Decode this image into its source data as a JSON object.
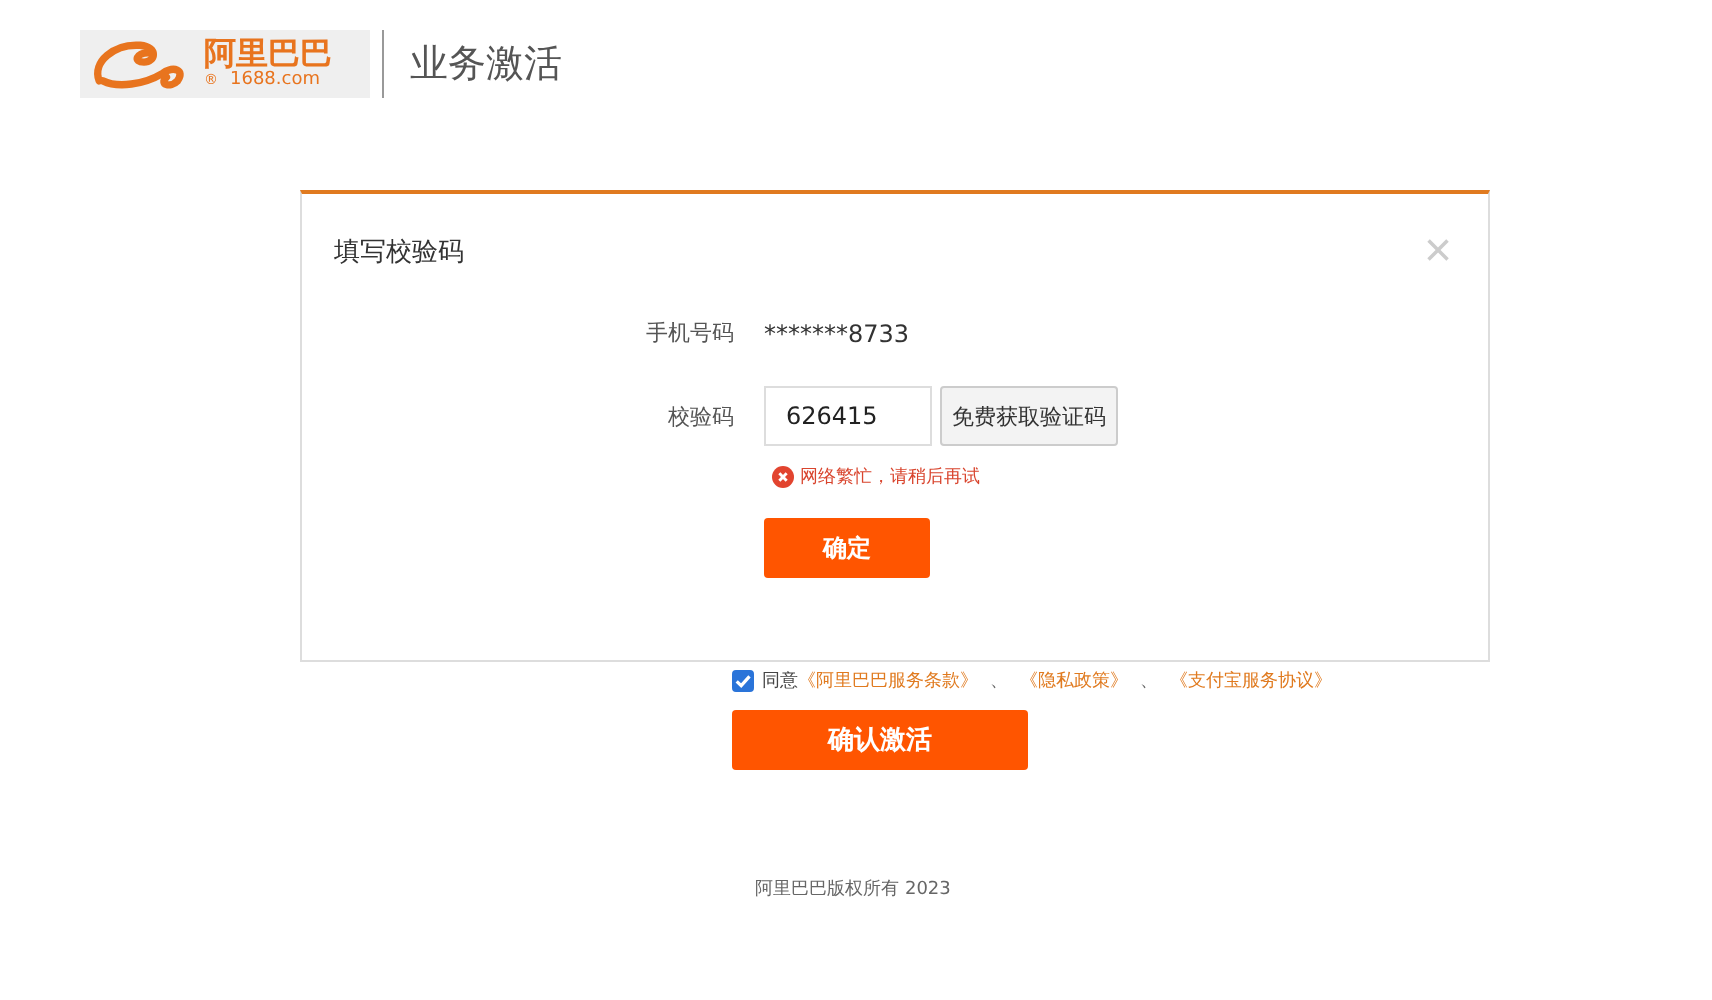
{
  "header": {
    "logo": {
      "name": "阿里巴巴",
      "domain": "1688.com",
      "mark": "®"
    },
    "title": "业务激活"
  },
  "dialog": {
    "title": "填写校验码",
    "close": "×",
    "phone": {
      "label": "手机号码",
      "value": "*******8733"
    },
    "code": {
      "label": "校验码",
      "value": "626415",
      "button": "免费获取验证码"
    },
    "error": "网络繁忙，请稍后再试",
    "confirm": "确定"
  },
  "agreement": {
    "checked": true,
    "prefix": "同意",
    "links": [
      "《阿里巴巴服务条款》",
      "《隐私政策》",
      "《支付宝服务协议》"
    ],
    "separators": [
      "、",
      "、"
    ]
  },
  "activate": "确认激活",
  "footer": "阿里巴巴版权所有 2023"
}
